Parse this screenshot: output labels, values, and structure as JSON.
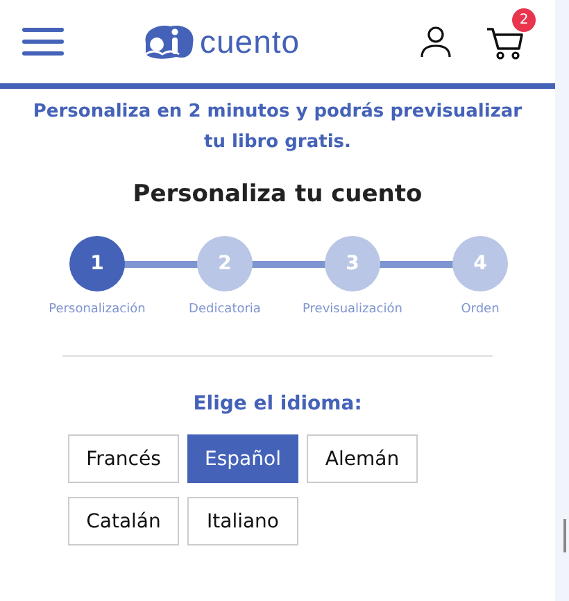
{
  "header": {
    "logo_text": "cuento",
    "cart_count": "2"
  },
  "intro": "Personaliza en 2 minutos y podrás previsualizar tu libro gratis.",
  "title": "Personaliza tu cuento",
  "steps": [
    {
      "number": "1",
      "label": "Personalización",
      "selected": true
    },
    {
      "number": "2",
      "label": "Dedicatoria",
      "selected": false
    },
    {
      "number": "3",
      "label": "Previsualización",
      "selected": false
    },
    {
      "number": "4",
      "label": "Orden",
      "selected": false
    }
  ],
  "language": {
    "heading": "Elige el idioma:",
    "options": [
      {
        "label": "Francés",
        "selected": false
      },
      {
        "label": "Español",
        "selected": true
      },
      {
        "label": "Alemán",
        "selected": false
      },
      {
        "label": "Catalán",
        "selected": false
      },
      {
        "label": "Italiano",
        "selected": false
      }
    ]
  }
}
